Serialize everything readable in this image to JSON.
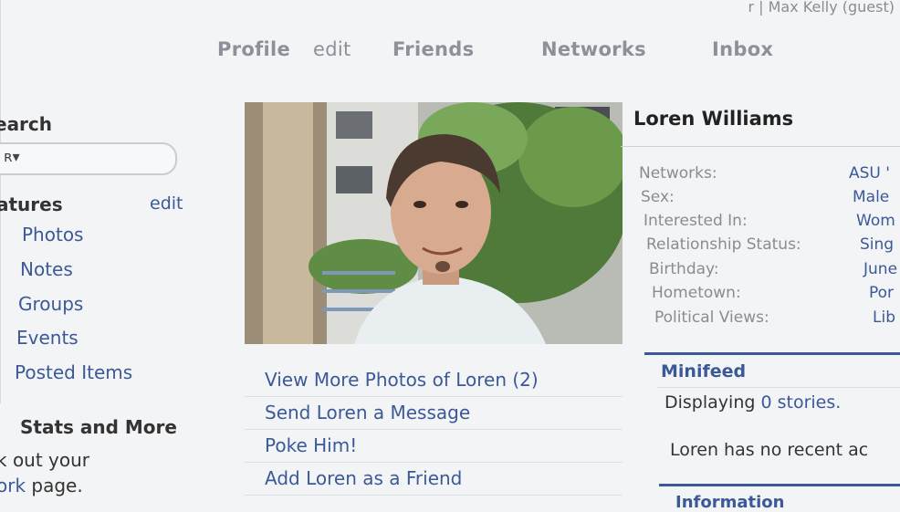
{
  "userbar": {
    "text": "r | Max Kelly (guest)"
  },
  "nav": {
    "profile": "Profile",
    "edit": "edit",
    "friends": "Friends",
    "networks": "Networks",
    "inbox": "Inbox"
  },
  "sidebar": {
    "search_title": "earch",
    "search_caret": "ʀ▾",
    "features_title": "atures",
    "features_edit": "edit",
    "items": [
      "Photos",
      "Notes",
      "Groups",
      "Events",
      "Posted Items"
    ],
    "stats_title": "Stats and More",
    "stats_line1": "k out your",
    "stats_link": "ork",
    "stats_line2_rest": " page."
  },
  "actions": [
    "View More Photos of Loren (2)",
    "Send Loren a Message",
    "Poke Him!",
    "Add Loren as a Friend"
  ],
  "profile": {
    "name": "Loren Williams",
    "fields": [
      {
        "label": "Networks:",
        "value": "ASU '"
      },
      {
        "label": "Sex:",
        "value": "Male"
      },
      {
        "label": "Interested In:",
        "value": "Wom"
      },
      {
        "label": "Relationship Status:",
        "value": "Sing"
      },
      {
        "label": "Birthday:",
        "value": "June"
      },
      {
        "label": "Hometown:",
        "value": "Por"
      },
      {
        "label": "Political Views:",
        "value": "Lib"
      }
    ]
  },
  "minifeed": {
    "title": "Minifeed",
    "display_prefix": "Displaying ",
    "display_link": "0 stories.",
    "no_recent": "Loren has no recent ac",
    "next_section": "Information"
  },
  "colors": {
    "link_blue": "#3b5998",
    "nav_gray": "#8d9099",
    "label_gray": "#888c93"
  }
}
